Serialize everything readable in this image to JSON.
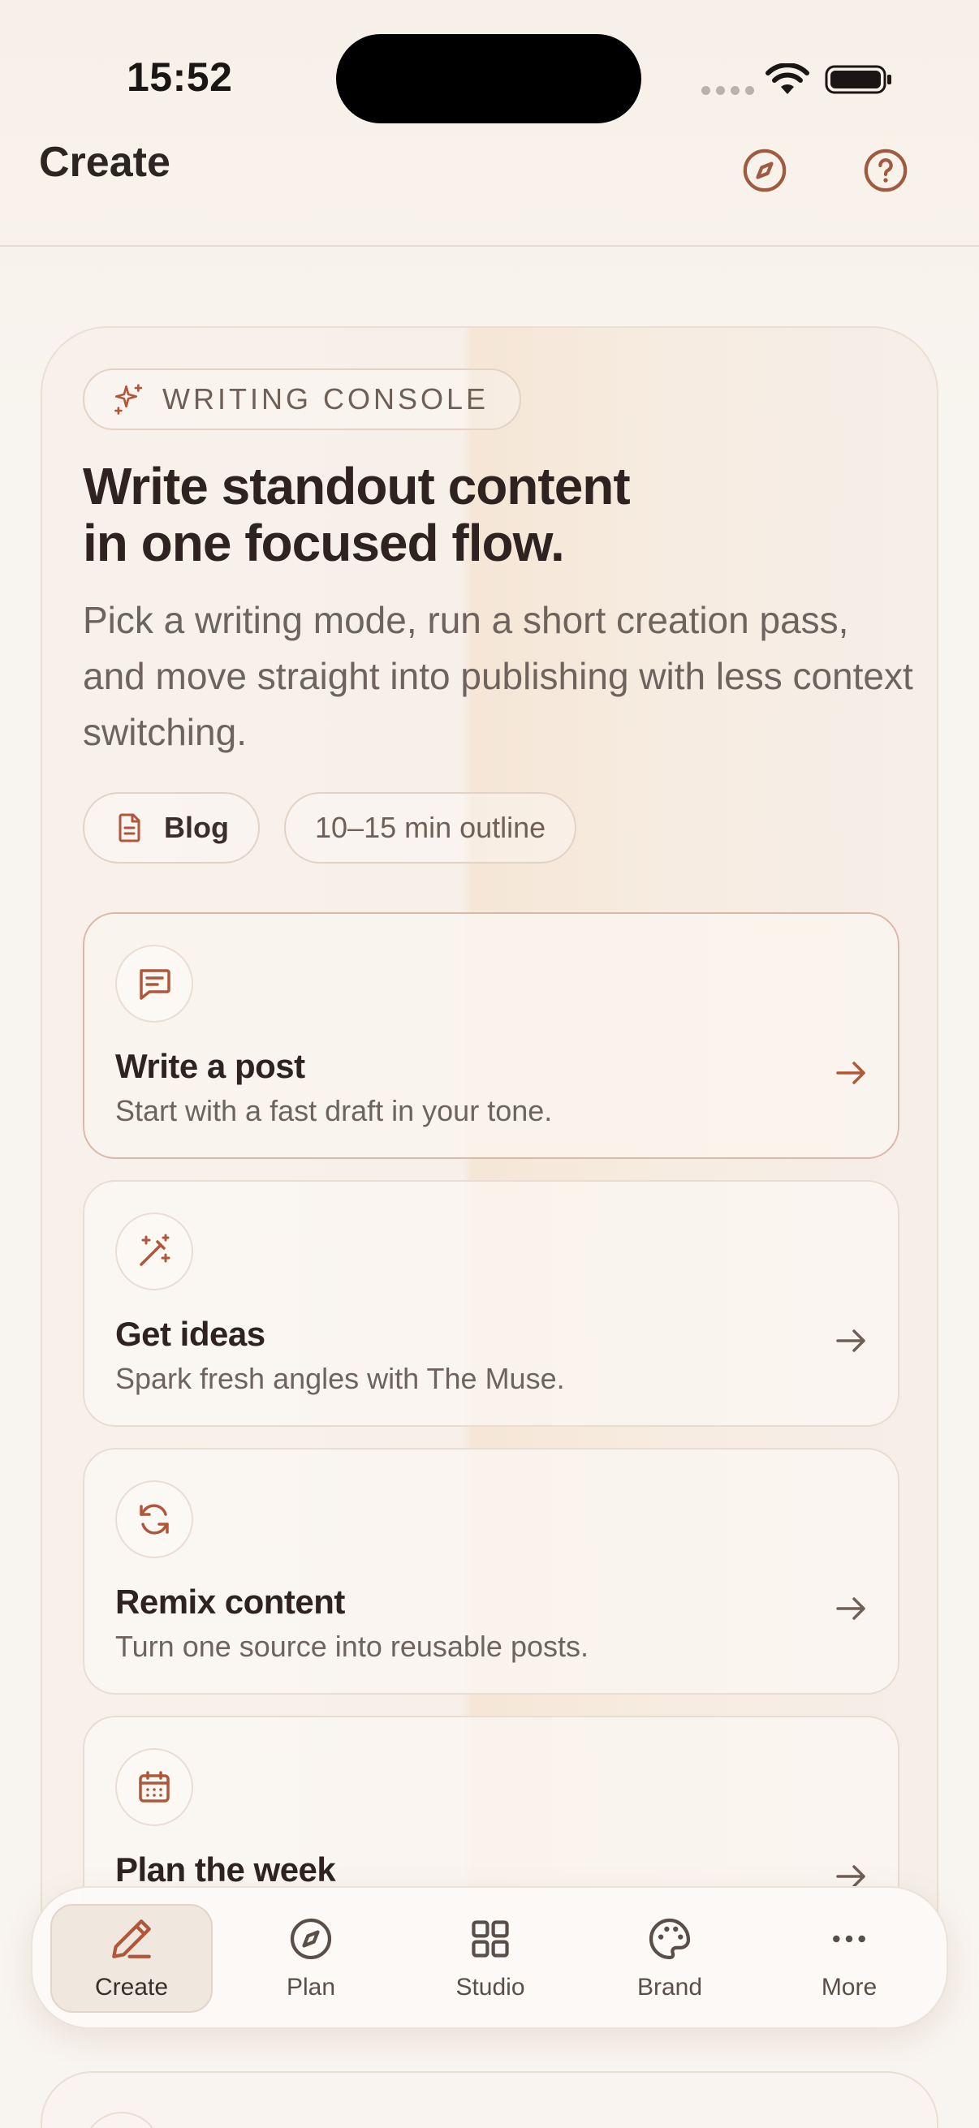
{
  "status_bar": {
    "time": "15:52"
  },
  "header": {
    "title": "Create"
  },
  "console": {
    "badge": "WRITING CONSOLE",
    "heading_line1": "Write standout content",
    "heading_line2": "in one focused flow.",
    "subtext": "Pick a writing mode, run a short creation pass, and move straight into publishing with less context switching.",
    "chips": [
      {
        "label": "Blog",
        "icon": "document-icon"
      },
      {
        "label": "10–15 min outline"
      }
    ],
    "modes": [
      {
        "title": "Write a post",
        "desc": "Start with a fast draft in your tone.",
        "icon": "message-icon",
        "active": true
      },
      {
        "title": "Get ideas",
        "desc": "Spark fresh angles with The Muse.",
        "icon": "magic-wand-icon"
      },
      {
        "title": "Remix content",
        "desc": "Turn one source into reusable posts.",
        "icon": "refresh-icon"
      },
      {
        "title": "Plan the week",
        "desc": "",
        "icon": "calendar-icon"
      }
    ]
  },
  "nav": {
    "items": [
      {
        "label": "Create",
        "icon": "pen-icon",
        "active": true
      },
      {
        "label": "Plan",
        "icon": "compass-icon"
      },
      {
        "label": "Studio",
        "icon": "grid-icon"
      },
      {
        "label": "Brand",
        "icon": "palette-icon"
      },
      {
        "label": "More",
        "icon": "more-icon"
      }
    ]
  },
  "colors": {
    "accent": "#b0573a",
    "text": "#2e2320",
    "muted": "#6e635d",
    "background": "#f8f4ef"
  }
}
